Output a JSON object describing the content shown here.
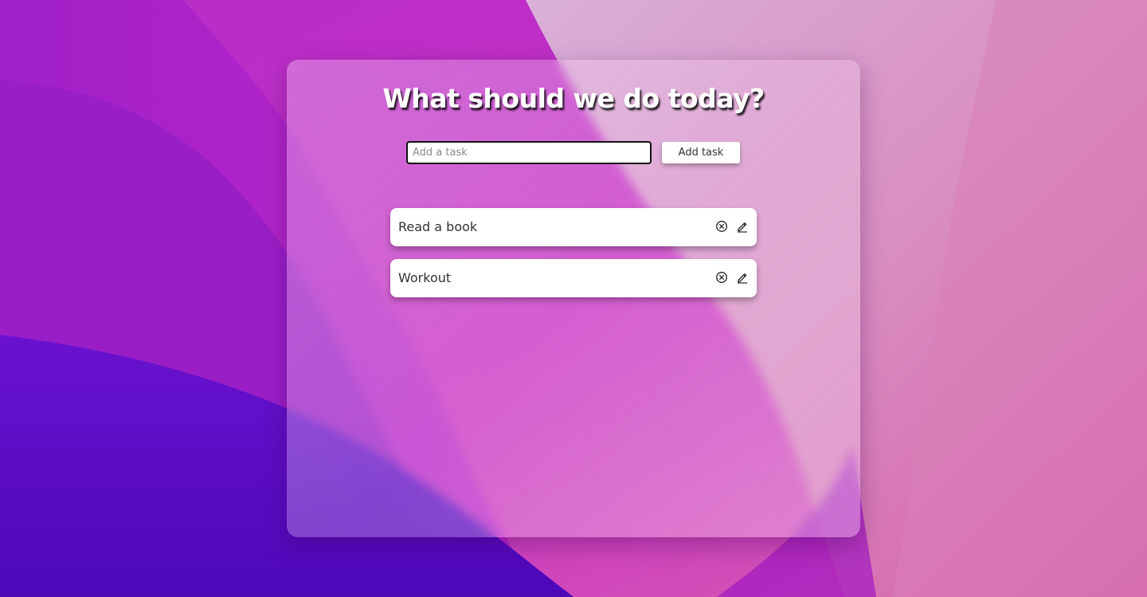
{
  "header": {
    "title": "What should we do today?"
  },
  "form": {
    "input_value": "",
    "input_placeholder": "Add a task",
    "add_button_label": "Add task"
  },
  "tasks": [
    {
      "label": "Read a book",
      "delete_icon": "close-circle-icon",
      "edit_icon": "pencil-icon"
    },
    {
      "label": "Workout",
      "delete_icon": "close-circle-icon",
      "edit_icon": "pencil-icon"
    }
  ],
  "colors": {
    "wallpaper_purple": "#5b10c9",
    "wallpaper_magenta": "#c92bc0",
    "wallpaper_pink": "#d778b8",
    "card_background": "#ffffff",
    "title_text": "#ffffff"
  }
}
